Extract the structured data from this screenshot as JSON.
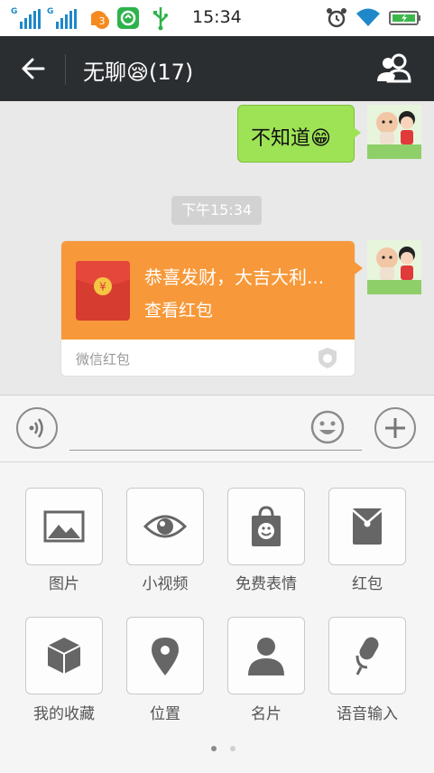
{
  "status_bar": {
    "sim1_label": "G",
    "sim2_label": "G",
    "notification_count": "3",
    "time": "15:34"
  },
  "header": {
    "title": "无聊😪(17)"
  },
  "messages": [
    {
      "text": "不知道😁"
    }
  ],
  "timestamp": "下午15:34",
  "red_packet": {
    "greeting": "恭喜发财，大吉大利...",
    "action": "查看红包",
    "footer": "微信红包"
  },
  "input": {
    "placeholder": ""
  },
  "panel": {
    "items": [
      {
        "label": "图片",
        "icon": "image-icon"
      },
      {
        "label": "小视频",
        "icon": "eye-icon"
      },
      {
        "label": "免费表情",
        "icon": "sticker-bag-icon"
      },
      {
        "label": "红包",
        "icon": "red-packet-icon"
      },
      {
        "label": "我的收藏",
        "icon": "cube-icon"
      },
      {
        "label": "位置",
        "icon": "location-pin-icon"
      },
      {
        "label": "名片",
        "icon": "person-icon"
      },
      {
        "label": "语音输入",
        "icon": "microphone-icon"
      }
    ],
    "page_count": 2,
    "current_page": 1
  },
  "colors": {
    "topbar": "#2b2e31",
    "sent_bubble": "#9ee356",
    "red_packet": "#f7993a",
    "status_blue": "#1e88c8"
  }
}
